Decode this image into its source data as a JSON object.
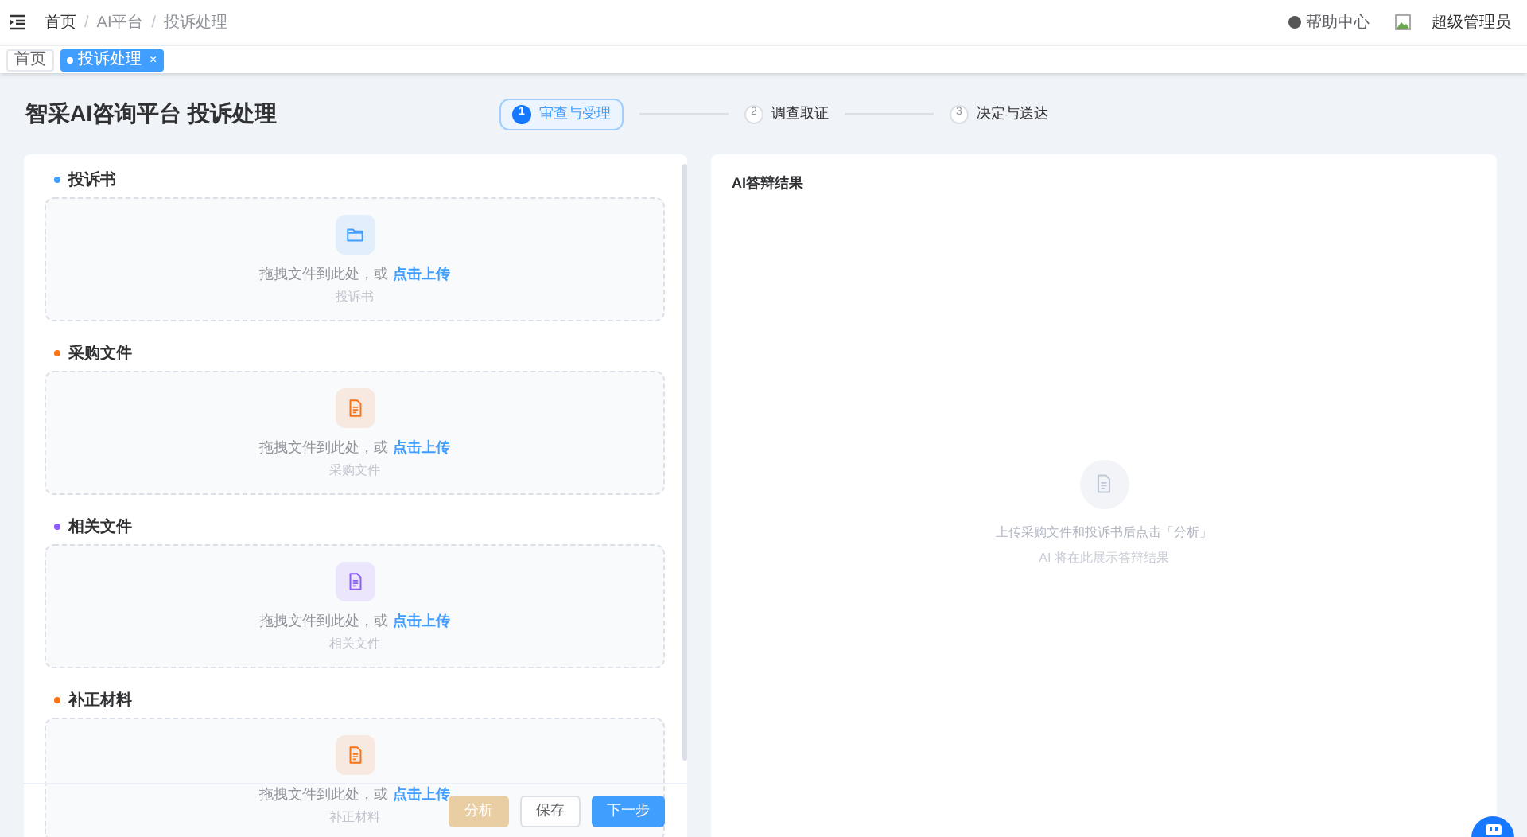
{
  "breadcrumb": [
    {
      "label": "首页"
    },
    {
      "separator": "/",
      "label": "AI平台"
    },
    {
      "separator": "/",
      "label": "投诉处理"
    }
  ],
  "header": {
    "help": "帮助中心",
    "user": "超级管理员"
  },
  "tabs": [
    {
      "label": "首页",
      "selected": false,
      "closable": false
    },
    {
      "label": "投诉处理",
      "selected": true,
      "closable": true,
      "close": "×"
    }
  ],
  "title": "智采AI咨询平台 投诉处理",
  "steps": [
    {
      "number": "1",
      "label": "审查与受理",
      "selected": true
    },
    {
      "number": "2",
      "label": "调查取证",
      "selected": false
    },
    {
      "number": "3",
      "label": "决定与送达",
      "selected": false
    }
  ],
  "uploads": [
    {
      "label": "投诉书",
      "color": "#409eff",
      "kind": "folder",
      "hint": "拖拽文件到此处，或 ",
      "link": "点击上传",
      "sub": "投诉书"
    },
    {
      "label": "采购文件",
      "color": "#f97316",
      "kind": "document",
      "hint": "拖拽文件到此处，或 ",
      "link": "点击上传",
      "sub": "采购文件"
    },
    {
      "label": "相关文件",
      "color": "#8b5cf6",
      "kind": "document",
      "hint": "拖拽文件到此处，或 ",
      "link": "点击上传",
      "sub": "相关文件"
    },
    {
      "label": "补正材料",
      "color": "#f97316",
      "kind": "document",
      "hint": "拖拽文件到此处，或 ",
      "link": "点击上传",
      "sub": "补正材料"
    }
  ],
  "actions": [
    {
      "label": "分析",
      "kind": "warning",
      "disabled": true
    },
    {
      "label": "保存",
      "kind": "default",
      "disabled": false
    },
    {
      "label": "下一步",
      "kind": "primary",
      "disabled": false
    }
  ],
  "result": {
    "title": "AI答辩结果",
    "empty": "上传采购文件和投诉书后点击「分析」",
    "empty_sub": "AI 将在此展示答辩结果"
  }
}
